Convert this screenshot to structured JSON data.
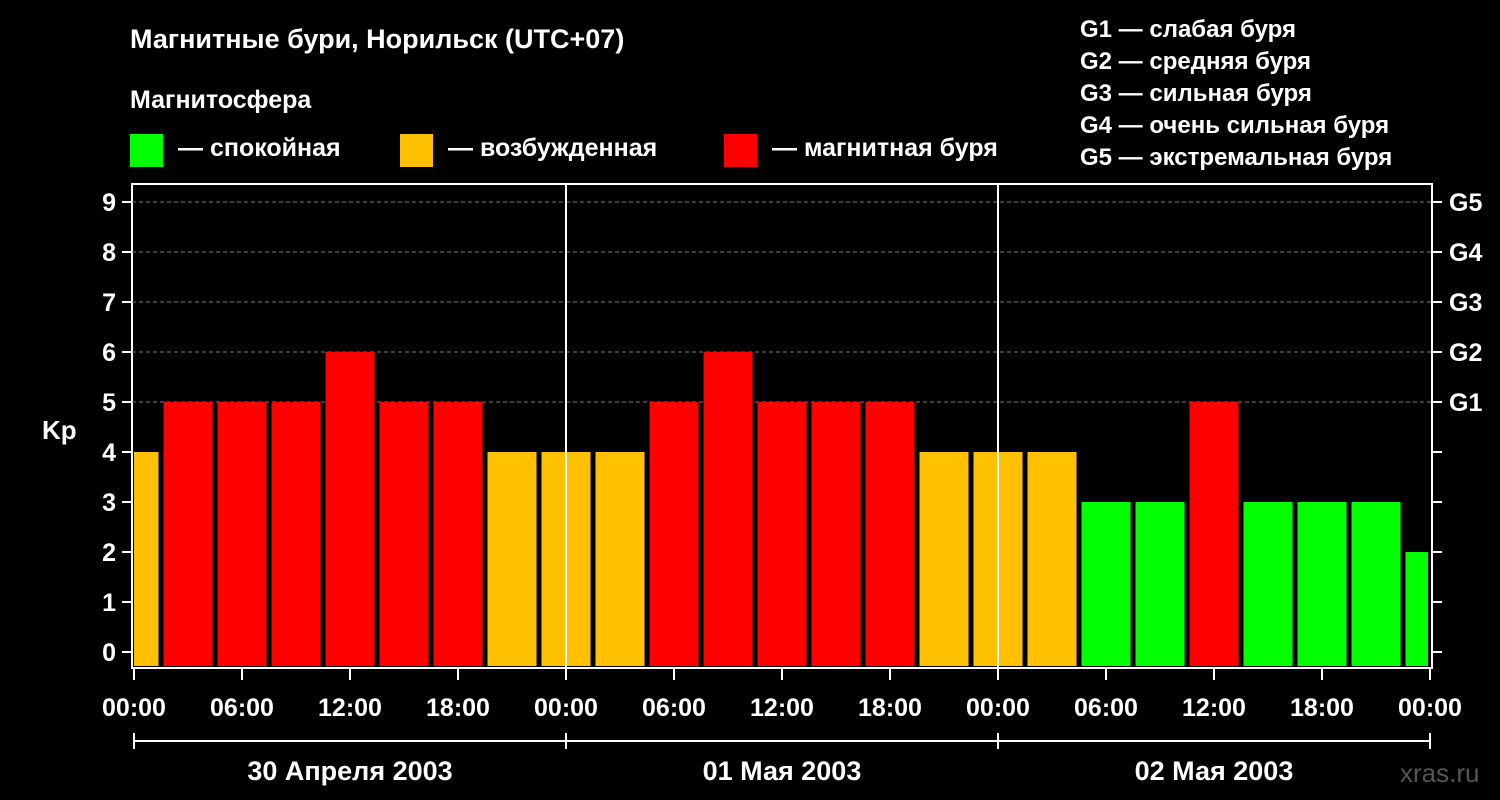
{
  "title": "Магнитные бури, Норильск (UTC+07)",
  "legend": {
    "title": "Магнитосфера",
    "items": [
      {
        "label": "— спокойная",
        "color": "#00ff00"
      },
      {
        "label": "— возбужденная",
        "color": "#ffc000"
      },
      {
        "label": "— магнитная буря",
        "color": "#ff0000"
      }
    ]
  },
  "gscale": [
    "G1 — слабая буря",
    "G2 — средняя буря",
    "G3 — сильная буря",
    "G4 — очень сильная буря",
    "G5 — экстремальная буря"
  ],
  "watermark": "xras.ru",
  "chart_data": {
    "type": "bar",
    "ylabel": "Kp",
    "ylim": [
      0,
      9
    ],
    "yticks": [
      "0",
      "1",
      "2",
      "3",
      "4",
      "5",
      "6",
      "7",
      "8",
      "9"
    ],
    "right_axis": [
      {
        "kp": 5,
        "label": "G1"
      },
      {
        "kp": 6,
        "label": "G2"
      },
      {
        "kp": 7,
        "label": "G3"
      },
      {
        "kp": 8,
        "label": "G4"
      },
      {
        "kp": 9,
        "label": "G5"
      }
    ],
    "grid": "horizontal dashed above Kp 5",
    "x_tick_labels": [
      "00:00",
      "06:00",
      "12:00",
      "18:00",
      "00:00",
      "06:00",
      "12:00",
      "18:00",
      "00:00",
      "06:00",
      "12:00",
      "18:00",
      "00:00"
    ],
    "days": [
      "30 Апреля 2003",
      "01 Мая 2003",
      "02 Мая 2003"
    ],
    "interval_hours": 3,
    "first_bar_partial": true,
    "values": [
      4,
      5,
      5,
      5,
      6,
      5,
      5,
      4,
      4,
      4,
      5,
      6,
      5,
      5,
      5,
      4,
      4,
      4,
      3,
      3,
      5,
      3,
      3,
      3,
      2
    ],
    "colors": {
      "quiet": "#00ff00",
      "active": "#ffc000",
      "storm": "#ff0000"
    }
  }
}
